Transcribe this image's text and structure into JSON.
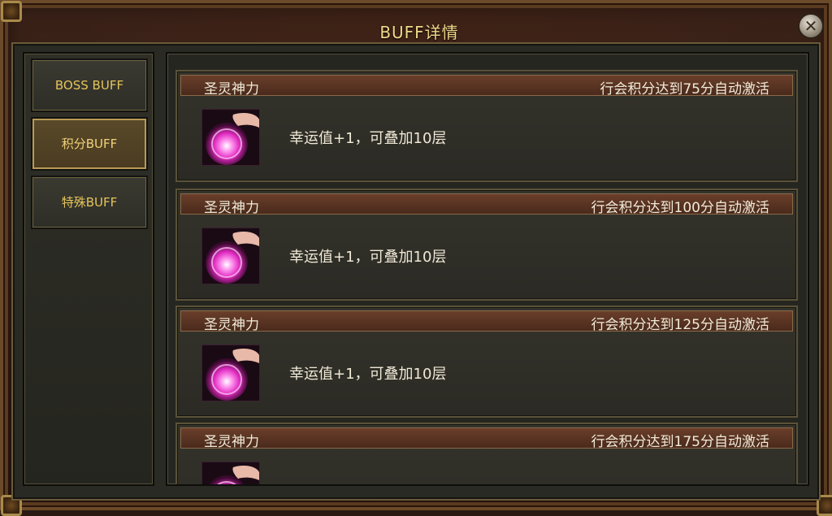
{
  "window": {
    "title": "BUFF详情",
    "close_symbol": "✕"
  },
  "sidebar": {
    "items": [
      {
        "label": "BOSS BUFF",
        "active": false
      },
      {
        "label": "积分BUFF",
        "active": true
      },
      {
        "label": "特殊BUFF",
        "active": false
      }
    ]
  },
  "buffs": [
    {
      "name": "圣灵神力",
      "condition": "行会积分达到75分自动激活",
      "description": "幸运值+1，可叠加10层",
      "icon": "pink-energy-orb-icon"
    },
    {
      "name": "圣灵神力",
      "condition": "行会积分达到100分自动激活",
      "description": "幸运值+1，可叠加10层",
      "icon": "pink-energy-orb-icon"
    },
    {
      "name": "圣灵神力",
      "condition": "行会积分达到125分自动激活",
      "description": "幸运值+1，可叠加10层",
      "icon": "pink-energy-orb-icon"
    },
    {
      "name": "圣灵神力",
      "condition": "行会积分达到175分自动激活",
      "description": "",
      "icon": "pink-energy-orb-icon"
    }
  ],
  "colors": {
    "title": "#f0d88a",
    "tab_text": "#e6c45a",
    "header_bg": "#5a3422",
    "orb": "#ff4fd8"
  }
}
